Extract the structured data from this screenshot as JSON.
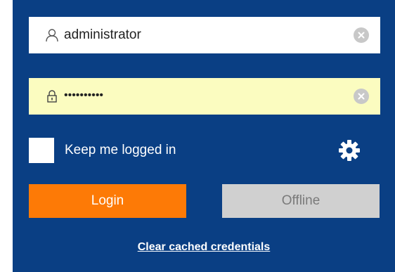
{
  "login_form": {
    "username": {
      "value": "administrator",
      "icon": "user-icon",
      "clear_icon": "clear-icon"
    },
    "password": {
      "value": "••••••••••",
      "icon": "lock-icon",
      "clear_icon": "clear-icon"
    },
    "keep_logged_in": {
      "label": "Keep me logged in",
      "checked": false
    },
    "settings_icon": "gear-icon",
    "login_label": "Login",
    "offline_label": "Offline",
    "clear_cache_label": "Clear cached credentials"
  },
  "colors": {
    "panel_background": "#0a3f84",
    "password_field_background": "#fbfcc0",
    "login_button": "#fd7a06",
    "offline_button": "#d0d0d0",
    "offline_text": "#7a7a7a",
    "clear_icon": "#c8c8c8"
  }
}
